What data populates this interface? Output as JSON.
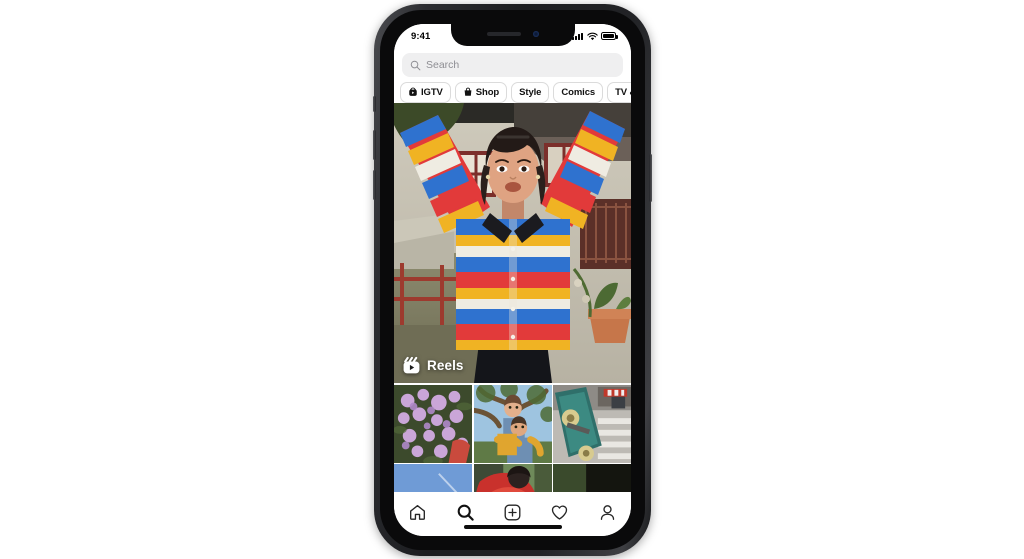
{
  "device": {
    "name": "iphone-mockup",
    "frame_color": "#2c2d31",
    "screen_bg": "#ffffff"
  },
  "status_bar": {
    "time": "9:41",
    "cellular_icon": "signal-bars-icon",
    "wifi_icon": "wifi-icon",
    "battery_icon": "battery-full-icon"
  },
  "search": {
    "placeholder": "Search",
    "value": "",
    "icon": "search-icon"
  },
  "chips": [
    {
      "label": "IGTV",
      "icon": "igtv-icon",
      "has_icon": true
    },
    {
      "label": "Shop",
      "icon": "shop-bag-icon",
      "has_icon": true
    },
    {
      "label": "Style",
      "icon": "",
      "has_icon": false
    },
    {
      "label": "Comics",
      "icon": "",
      "has_icon": false
    },
    {
      "label": "TV & Movies",
      "icon": "",
      "has_icon": false
    }
  ],
  "feed": {
    "hero": {
      "badge_label": "Reels",
      "badge_icon": "reels-clapperboard-icon",
      "description": "woman in red blue yellow striped shirt with arms raised outside house"
    },
    "grid": [
      {
        "description": "purple lilac flowers blossom"
      },
      {
        "description": "two children piggyback under tree"
      },
      {
        "description": "skateboard on crosswalk street"
      },
      {
        "description": "hands against blue sky"
      },
      {
        "description": "person in red dress fabric"
      },
      {
        "description": "dark haired person close up"
      }
    ]
  },
  "tabbar": {
    "items": [
      {
        "name": "home",
        "icon": "home-icon",
        "active": false
      },
      {
        "name": "search",
        "icon": "search-icon",
        "active": true
      },
      {
        "name": "create",
        "icon": "plus-square-icon",
        "active": false
      },
      {
        "name": "activity",
        "icon": "heart-icon",
        "active": false
      },
      {
        "name": "profile",
        "icon": "person-icon",
        "active": false
      }
    ],
    "home_indicator": true
  },
  "colors": {
    "page_bg": "#ffffff",
    "search_bg": "#efeff0",
    "chip_border": "#dbdbdb",
    "text_primary": "#121212",
    "text_muted": "#8e8e93"
  }
}
